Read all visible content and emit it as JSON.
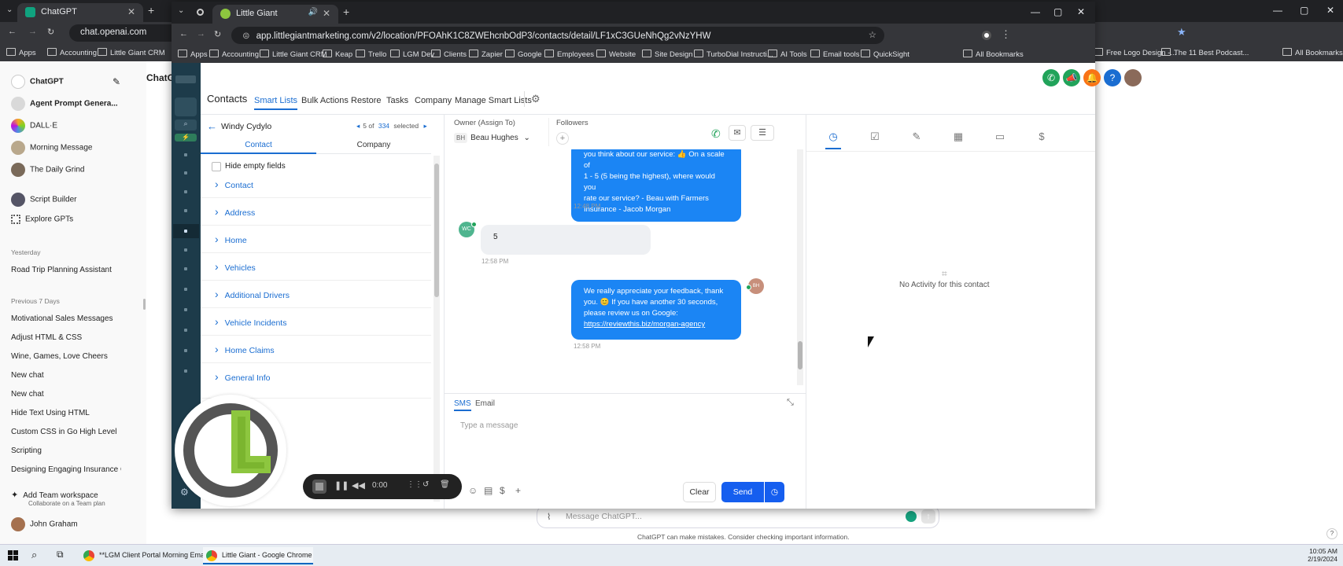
{
  "bg_browser": {
    "tab_title": "ChatGPT",
    "url": "chat.openai.com",
    "bookmarks": [
      "Apps",
      "Accounting",
      "Little Giant CRM",
      "Free Logo Design -...",
      "The 11 Best Podcast...",
      "All Bookmarks"
    ]
  },
  "chatgpt": {
    "top_items": [
      {
        "label": "ChatGPT",
        "icon": "openai-icon"
      },
      {
        "label": "Agent Prompt Genera...",
        "icon": "gpt-avatar-icon"
      },
      {
        "label": "DALL·E",
        "icon": "dalle-icon"
      },
      {
        "label": "Morning Message",
        "icon": "gpt-avatar-icon"
      },
      {
        "label": "The Daily Grind",
        "icon": "gpt-avatar-icon"
      },
      {
        "label": "Script Builder",
        "icon": "gpt-avatar-icon"
      },
      {
        "label": "Explore GPTs",
        "icon": "grid-icon"
      }
    ],
    "heading_yesterday": "Yesterday",
    "yesterday_items": [
      "Road Trip Planning Assistant"
    ],
    "heading_prev7": "Previous 7 Days",
    "prev7_items": [
      "Motivational Sales Messages",
      "Adjust HTML & CSS",
      "Wine, Games, Love Cheers",
      "New chat",
      "New chat",
      "Hide Text Using HTML",
      "Custom CSS in Go High Level",
      "Scripting",
      "Designing Engaging Insurance G"
    ],
    "team_title": "Add Team workspace",
    "team_sub": "Collaborate on a Team plan",
    "user": "John Graham",
    "main_title": "ChatG",
    "input_placeholder": "Message ChatGPT...",
    "disclaimer": "ChatGPT can make mistakes. Consider checking important information.",
    "help": "?"
  },
  "taskbar": {
    "apps": [
      "**LGM Client Portal Morning Ema...",
      "Little Giant - Google Chrome"
    ],
    "time": "10:05 AM",
    "date": "2/19/2024"
  },
  "win": {
    "tab_title": "Little Giant",
    "url": "app.littlegiantmarketing.com/v2/location/PFOAhK1C8ZWEhcnbOdP3/contacts/detail/LF1xC3GUeNhQg2vNzYHW",
    "bookmarks": [
      "Apps",
      "Accounting",
      "Little Giant CRM",
      "Keap",
      "Trello",
      "LGM Dev",
      "Clients",
      "Zapier",
      "Google",
      "Employees",
      "Website",
      "Site Design",
      "TurboDial Instructi...",
      "AI Tools",
      "Email tools",
      "QuickSight",
      "All Bookmarks"
    ]
  },
  "app": {
    "section": "Contacts",
    "nav": [
      "Smart Lists",
      "Bulk Actions",
      "Restore",
      "Tasks",
      "Company",
      "Manage Smart Lists"
    ],
    "contact_name": "Windy Cydylo",
    "pager": {
      "position": "5 of",
      "total": "334",
      "selected": "selected"
    },
    "tabs": [
      "Contact",
      "Company"
    ],
    "hide_empty": "Hide empty fields",
    "sections": [
      "Contact",
      "Address",
      "Home",
      "Vehicles",
      "Additional Drivers",
      "Vehicle Incidents",
      "Home Claims",
      "General Info"
    ],
    "owner_label": "Owner (Assign To)",
    "owner_initials": "BH",
    "owner_name": "Beau Hughes",
    "followers_label": "Followers",
    "messages": {
      "m1_lines": [
        "you think about our service: 👍 On a scale of",
        "1 - 5 (5 being the highest), where would you",
        "rate our service? - Beau with Farmers",
        "Insurance - Jacob Morgan"
      ],
      "m1_time": "12:48 PM",
      "m2_avatar": "WC",
      "m2_text": "5",
      "m2_time": "12:58 PM",
      "m3_lines": [
        "We really appreciate your feedback, thank",
        "you. 😊 If you have another 30 seconds,",
        "please review us on Google:"
      ],
      "m3_link": "https://reviewthis.biz/morgan-agency",
      "m3_time": "12:58 PM",
      "m3_avatar": "BH"
    },
    "compose_tabs": [
      "SMS",
      "Email"
    ],
    "compose_placeholder": "Type a message",
    "clear": "Clear",
    "send": "Send",
    "no_activity": "No Activity for this contact"
  },
  "recorder": {
    "time": "0:00"
  },
  "colors": {
    "primary": "#1b85f4",
    "send": "#155eef",
    "rail": "#1d3b4a",
    "logo_green": "#8dc63f",
    "logo_gray": "#555555"
  }
}
